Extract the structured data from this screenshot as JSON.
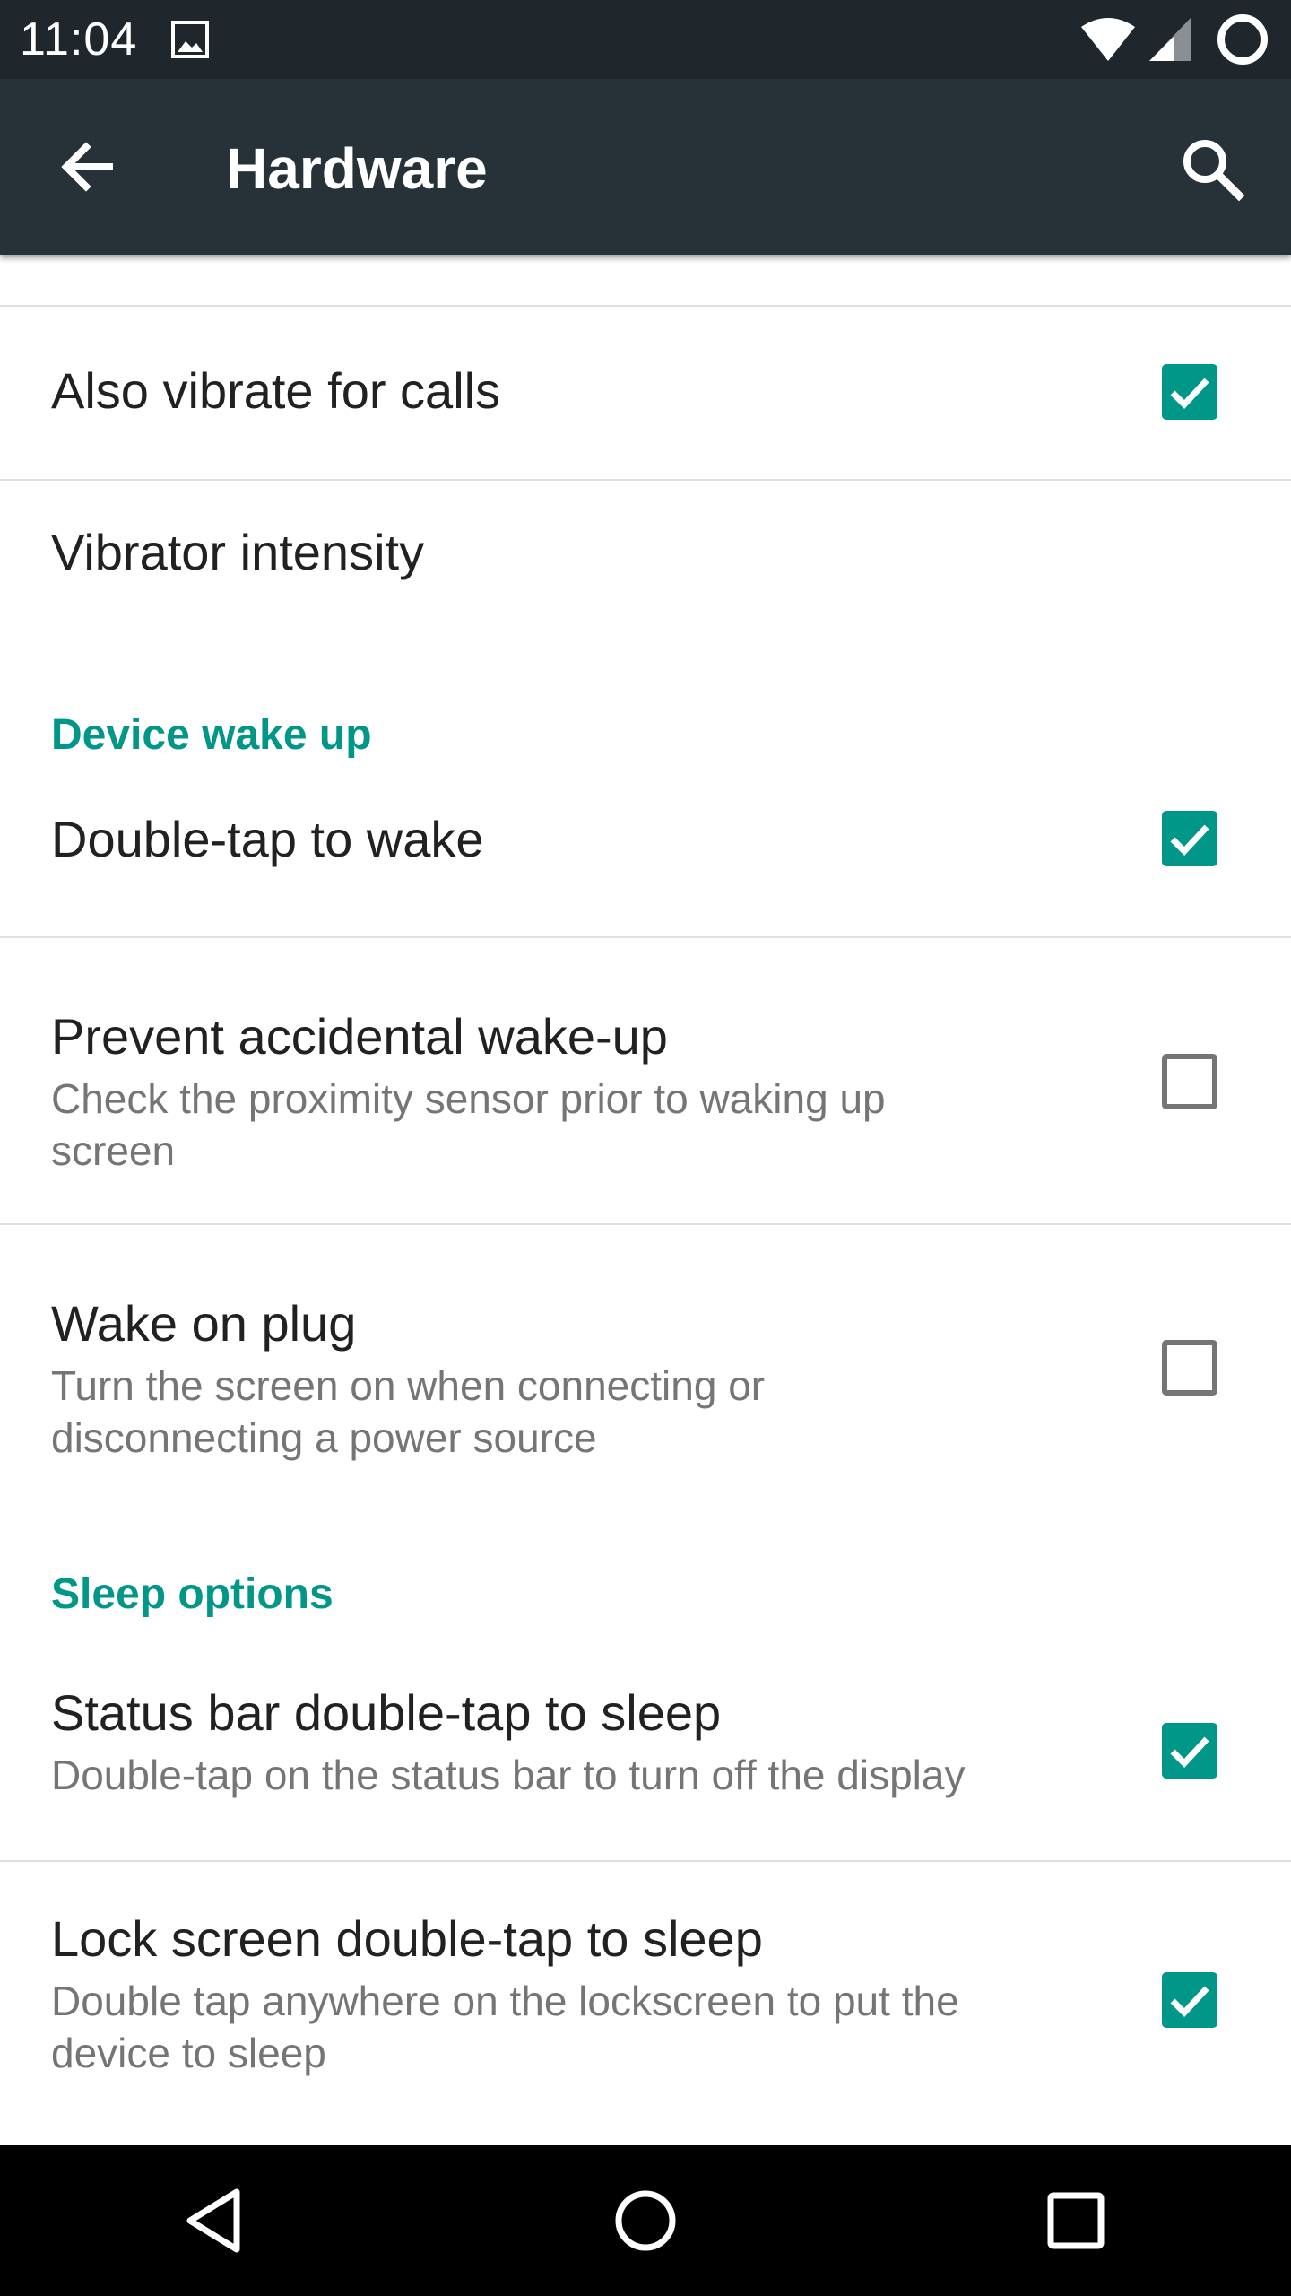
{
  "status_bar": {
    "time": "11:04",
    "icons": [
      "image-icon",
      "wifi-icon",
      "signal-icon",
      "battery-icon"
    ]
  },
  "toolbar": {
    "title": "Hardware",
    "back_icon": "arrow-back-icon",
    "search_icon": "search-icon",
    "background": "#263238"
  },
  "colors": {
    "accent": "#009688",
    "primary_text": "#212121",
    "secondary_text": "#757575",
    "status_bar": "#1f272d"
  },
  "items": {
    "vibrate_calls": {
      "title": "Also vibrate for calls",
      "checked": true
    },
    "vibrator_intensity": {
      "title": "Vibrator intensity"
    },
    "section_wake": {
      "title": "Device wake up"
    },
    "double_tap_wake": {
      "title": "Double-tap to wake",
      "checked": true
    },
    "prevent_wake": {
      "title": "Prevent accidental wake-up",
      "summary_line1": "Check the proximity sensor prior to waking up",
      "summary_line2": "screen",
      "checked": false
    },
    "wake_on_plug": {
      "title": "Wake on plug",
      "summary_line1": "Turn the screen on when connecting or",
      "summary_line2": "disconnecting a power source",
      "checked": false
    },
    "section_sleep": {
      "title": "Sleep options"
    },
    "statusbar_sleep": {
      "title": "Status bar double-tap to sleep",
      "summary_line1": "Double-tap on the status bar to turn off the display",
      "checked": true
    },
    "lockscreen_sleep": {
      "title": "Lock screen double-tap to sleep",
      "summary_line1": "Double tap anywhere on the lockscreen to put the",
      "summary_line2": "device to sleep",
      "checked": true
    }
  },
  "nav_bar": {
    "icons": [
      "nav-back-icon",
      "nav-home-icon",
      "nav-recents-icon"
    ]
  }
}
